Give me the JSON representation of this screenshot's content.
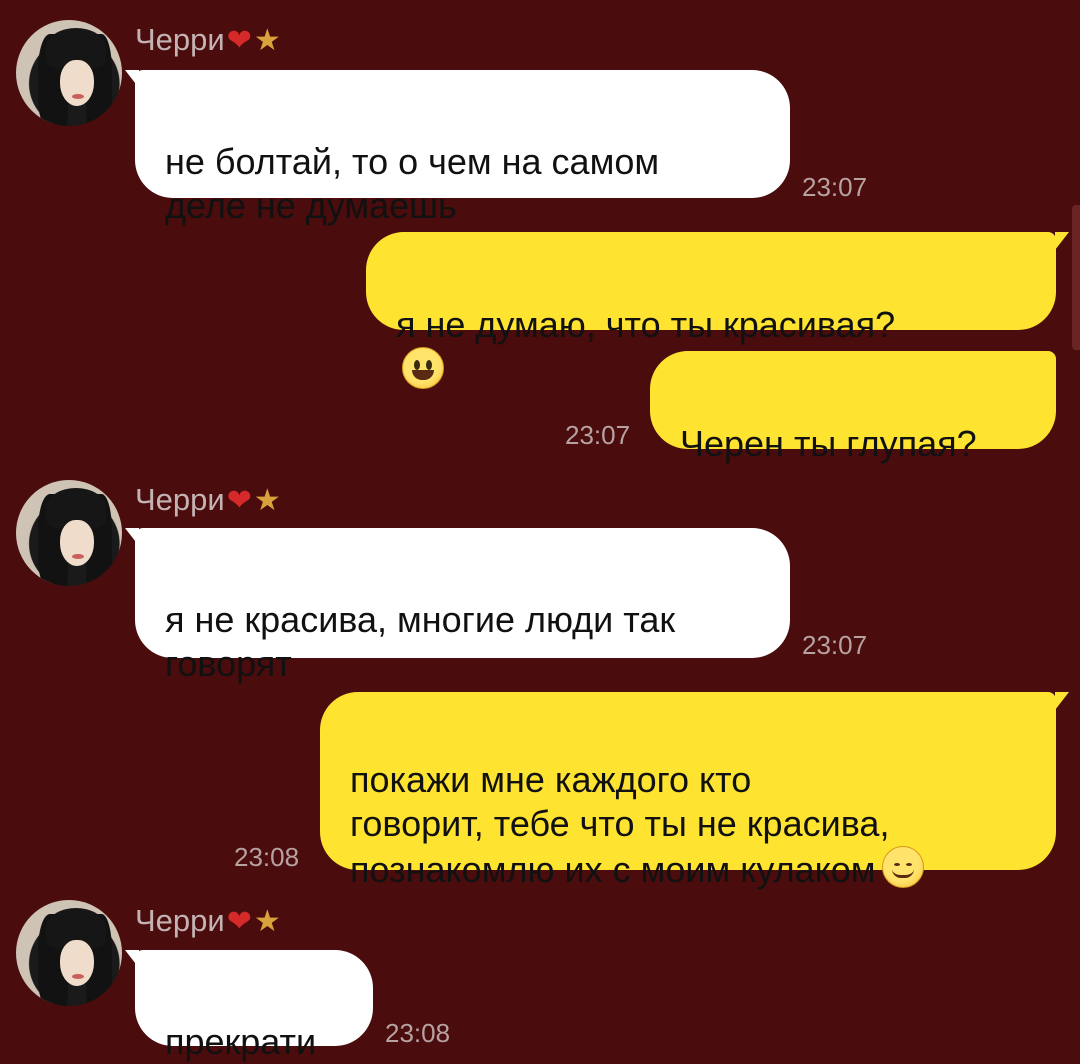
{
  "messages": [
    {
      "sender": "Черри",
      "text": "не болтай, то о чем на самом\nделе не думаешь",
      "time": "23:07"
    },
    {
      "text": "я не думаю, что ты красивая?",
      "emoji": "grinning-face-emoji"
    },
    {
      "text": "Черен ты глупая?",
      "time": "23:07"
    },
    {
      "sender": "Черри",
      "text": "я не красива, многие люди так\nговорят",
      "time": "23:07"
    },
    {
      "text": "покажи мне каждого кто\nговорит, тебе что ты не красива,\nпознакомлю их с моим кулаком",
      "emoji": "smiling-blush-emoji",
      "time": "23:08"
    },
    {
      "sender": "Черри",
      "text": "прекрати",
      "time": "23:08"
    }
  ],
  "colors": {
    "background": "#4a0c0c",
    "incoming_bubble": "#ffffff",
    "outgoing_bubble": "#fee331",
    "heart": "#d62a2a"
  },
  "icons": {
    "heart": "heart-icon",
    "star": "star-icon"
  }
}
